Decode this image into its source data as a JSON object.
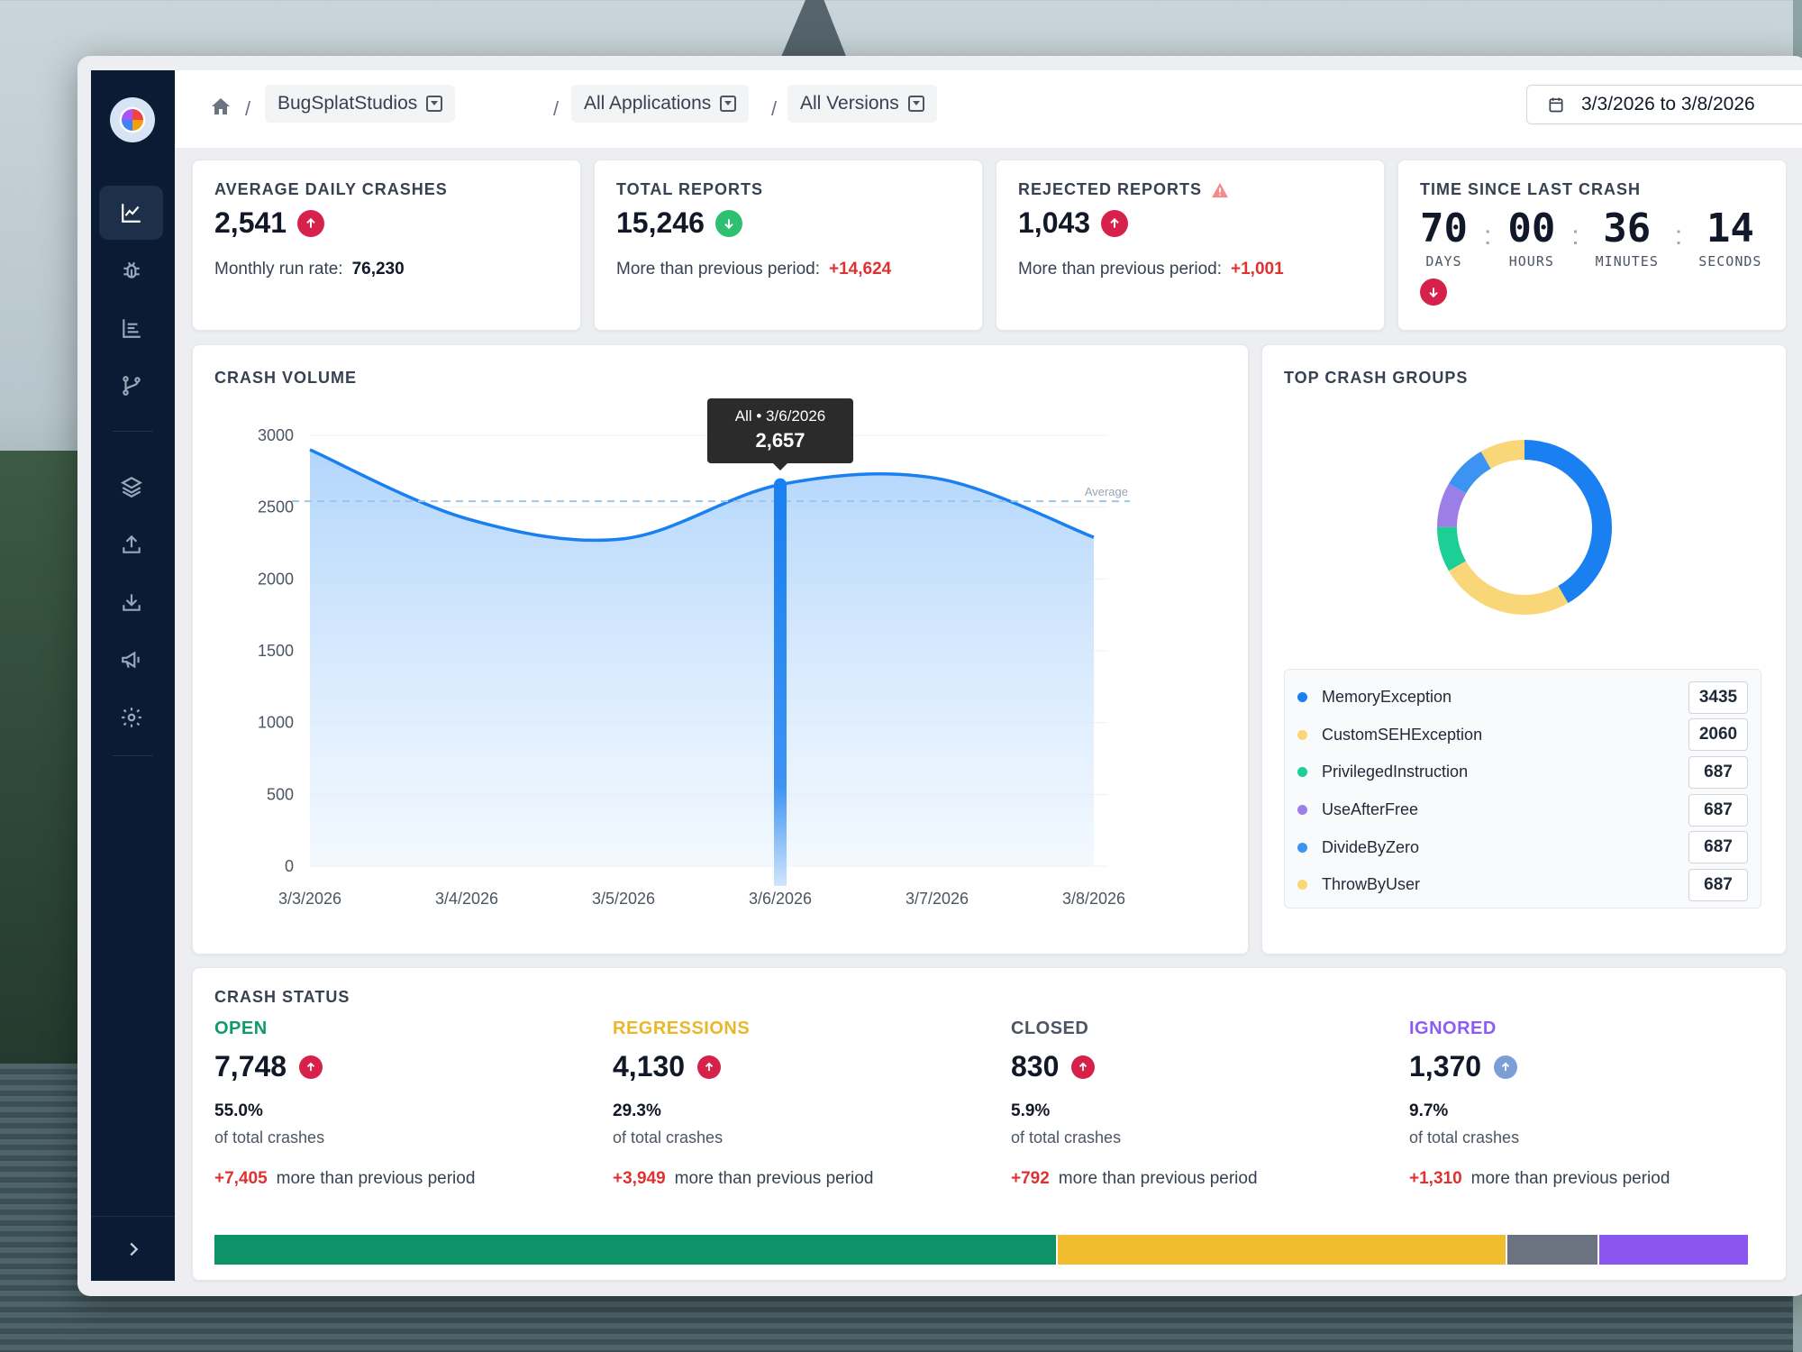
{
  "breadcrumb": {
    "items": [
      {
        "label": "BugSplatStudios"
      },
      {
        "label": "All Applications"
      },
      {
        "label": "All Versions"
      }
    ],
    "separator": "/"
  },
  "date_range": "3/3/2026 to 3/8/2026",
  "nav_icons": [
    "chart-line-icon",
    "bug-icon",
    "list-icon",
    "branch-icon",
    "layers-icon",
    "upload-icon",
    "download-icon",
    "megaphone-icon",
    "gear-icon"
  ],
  "stats": {
    "avg_daily": {
      "title": "AVERAGE DAILY CRASHES",
      "value": "2,541",
      "trend": "up",
      "sub_label": "Monthly run rate:",
      "sub_value": "76,230"
    },
    "total_reports": {
      "title": "TOTAL REPORTS",
      "value": "15,246",
      "trend": "down",
      "sub_label": "More than previous period:",
      "sub_value": "+14,624"
    },
    "rejected": {
      "title": "REJECTED REPORTS",
      "value": "1,043",
      "trend": "up",
      "sub_label": "More than previous period:",
      "sub_value": "+1,001"
    },
    "last_crash": {
      "title": "TIME SINCE LAST CRASH",
      "units": [
        {
          "value": "70",
          "label": "DAYS"
        },
        {
          "value": "00",
          "label": "HOURS"
        },
        {
          "value": "36",
          "label": "MINUTES"
        },
        {
          "value": "14",
          "label": "SECONDS"
        }
      ]
    }
  },
  "crash_volume": {
    "title": "CRASH VOLUME",
    "tooltip_header": "All • 3/6/2026",
    "tooltip_value": "2,657",
    "average_label": "Average"
  },
  "chart_data": [
    {
      "type": "area",
      "x": [
        "3/3/2026",
        "3/4/2026",
        "3/5/2026",
        "3/6/2026",
        "3/7/2026",
        "3/8/2026"
      ],
      "y_ticks": [
        0,
        500,
        1000,
        1500,
        2000,
        2500,
        3000
      ],
      "ylim": [
        0,
        3000
      ],
      "series": [
        {
          "values": [
            2900,
            2420,
            2280,
            2657,
            2700,
            2290
          ]
        }
      ],
      "average_line": 2541,
      "highlight_x": "3/6/2026",
      "grid": true
    },
    {
      "type": "pie",
      "title": "TOP CRASH GROUPS",
      "categories": [
        "MemoryException",
        "CustomSEHException",
        "PrivilegedInstruction",
        "UseAfterFree",
        "DivideByZero",
        "ThrowByUser"
      ],
      "values": [
        3435,
        2060,
        687,
        687,
        687,
        687
      ],
      "colors": [
        "#1a7ff0",
        "#f9d779",
        "#1ccf94",
        "#9b7fe6",
        "#3d93f2",
        "#f9d779"
      ]
    }
  ],
  "crash_status": {
    "title": "CRASH STATUS",
    "columns": [
      {
        "label": "OPEN",
        "value": "7,748",
        "pct": "55.0%",
        "of": "of total crashes",
        "delta": "+7,405",
        "more": "more than previous period",
        "color": "#0e9a6a",
        "arrow": "up"
      },
      {
        "label": "REGRESSIONS",
        "value": "4,130",
        "pct": "29.3%",
        "of": "of total crashes",
        "delta": "+3,949",
        "more": "more than previous period",
        "color": "#eab72a",
        "arrow": "up"
      },
      {
        "label": "CLOSED",
        "value": "830",
        "pct": "5.9%",
        "of": "of total crashes",
        "delta": "+792",
        "more": "more than previous period",
        "color": "#4b5563",
        "arrow": "up"
      },
      {
        "label": "IGNORED",
        "value": "1,370",
        "pct": "9.7%",
        "of": "of total crashes",
        "delta": "+1,310",
        "more": "more than previous period",
        "color": "#8b5cf6",
        "arrow": "up"
      }
    ],
    "bar_shares": [
      55.0,
      29.3,
      5.9,
      9.7
    ],
    "bar_colors": [
      "#0e9268",
      "#f0bd2e",
      "#6b7280",
      "#8b55f0"
    ]
  }
}
